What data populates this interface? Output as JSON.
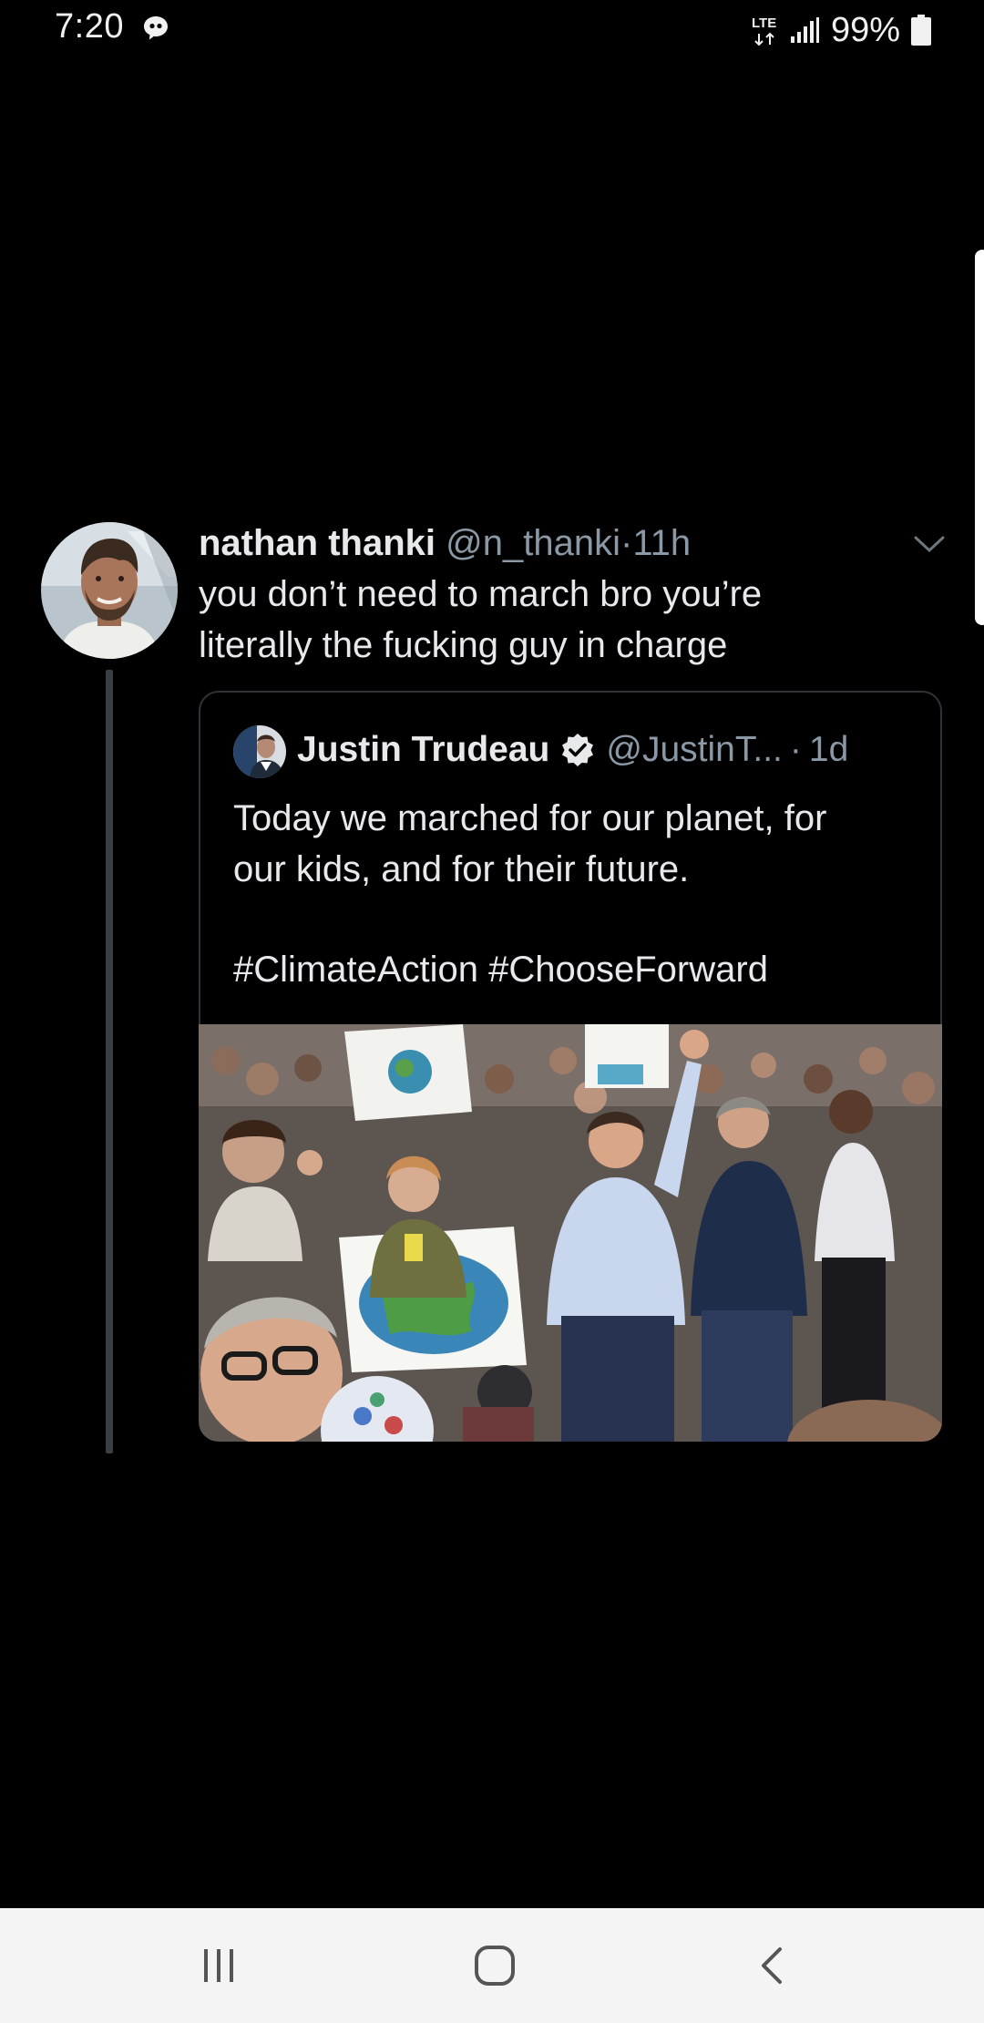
{
  "status_bar": {
    "time": "7:20",
    "network": "LTE",
    "battery": "99%",
    "icons": [
      "chat-notification-icon",
      "lte-icon",
      "signal-icon",
      "battery-icon"
    ]
  },
  "tweet": {
    "author_name": "nathan thanki",
    "author_handle": "@n_thanki",
    "separator": "·",
    "time": "11h",
    "text_lines": [
      "you don’t need to march bro you’re",
      "literally the fucking guy in charge"
    ],
    "menu_icon": "chevron-down-icon"
  },
  "quote": {
    "author_name": "Justin Trudeau",
    "verified": true,
    "author_handle": "@JustinT...",
    "separator": "·",
    "time": "1d",
    "text_lines": [
      "Today we marched for our planet, for",
      "our kids, and for their future."
    ],
    "hashtags": "#ClimateAction #ChooseForward",
    "photo_icon": "march-photo"
  },
  "nav_bar": {
    "buttons": [
      "recent-apps-icon",
      "home-icon",
      "back-icon"
    ]
  },
  "colors": {
    "background": "#000000",
    "text_primary": "#e7e9ea",
    "text_secondary": "#8b98a5",
    "border": "#2f3336",
    "nav_background": "#f4f4f4"
  }
}
